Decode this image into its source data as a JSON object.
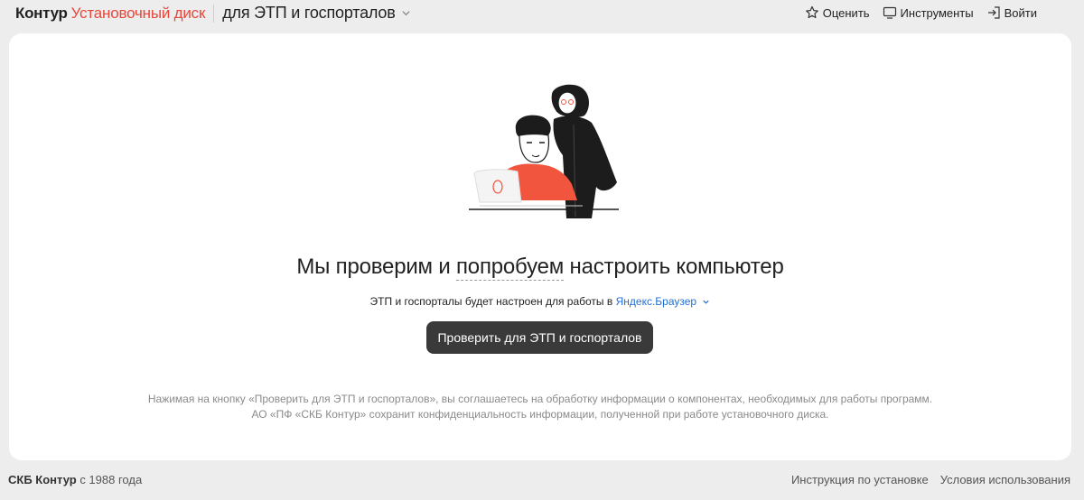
{
  "header": {
    "brand_main": "Контур",
    "brand_product": "Установочный диск",
    "section": "для ЭТП и госпорталов",
    "actions": {
      "rate": "Оценить",
      "tools": "Инструменты",
      "login": "Войти"
    }
  },
  "main": {
    "headline_before": "Мы проверим и ",
    "headline_dashed": "попробуем",
    "headline_after": " настроить компьютер",
    "subline_text": "ЭТП и госпорталы будет настроен для работы в ",
    "browser_link": "Яндекс.Браузер",
    "cta_label": "Проверить для ЭТП и госпорталов",
    "disclaimer_line1": "Нажимая на кнопку «Проверить для ЭТП и госпорталов», вы соглашаетесь на обработку информации о компонентах, необходимых для работы программ.",
    "disclaimer_line2": "АО «ПФ «СКБ Контур» сохранит конфиденциальность информации, полученной при работе установочного диска."
  },
  "footer": {
    "company": "СКБ Контур",
    "since": " с 1988 года",
    "links": {
      "install_guide": "Инструкция по установке",
      "terms": "Условия использования"
    }
  },
  "colors": {
    "brand_red": "#e8473b",
    "link_blue": "#1f6fd6",
    "button_dark": "#3a3a3a",
    "shirt_red": "#f2553d"
  },
  "icons": {
    "rate": "star-icon",
    "tools": "monitor-icon",
    "login": "login-arrow-icon"
  }
}
